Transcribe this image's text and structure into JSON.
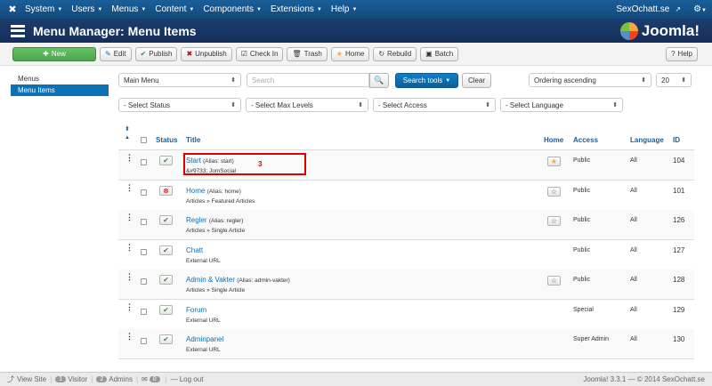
{
  "topbar": {
    "menus": [
      "System",
      "Users",
      "Menus",
      "Content",
      "Components",
      "Extensions",
      "Help"
    ],
    "site_name": "SexOchatt.se"
  },
  "header": {
    "title": "Menu Manager: Menu Items",
    "brand": "Joomla!"
  },
  "toolbar": {
    "new": "New",
    "edit": "Edit",
    "publish": "Publish",
    "unpublish": "Unpublish",
    "checkin": "Check In",
    "trash": "Trash",
    "home": "Home",
    "rebuild": "Rebuild",
    "batch": "Batch",
    "help": "Help"
  },
  "sidebar": {
    "items": [
      {
        "label": "Menus"
      },
      {
        "label": "Menu Items"
      }
    ]
  },
  "filters": {
    "menu_select": "Main Menu",
    "search_placeholder": "Search",
    "search_tools": "Search tools",
    "clear": "Clear",
    "ordering": "Ordering ascending",
    "limit": "20",
    "status": "- Select Status",
    "max_levels": "- Select Max Levels",
    "access": "- Select Access",
    "language": "- Select Language"
  },
  "table": {
    "headers": {
      "status": "Status",
      "title": "Title",
      "home": "Home",
      "access": "Access",
      "language": "Language",
      "id": "ID"
    },
    "rows": [
      {
        "title": "Start",
        "alias": "(Alias: start)",
        "sub": "&#9733; JomSocial",
        "published": true,
        "home": true,
        "access": "Public",
        "language": "All",
        "id": "104"
      },
      {
        "title": "Home",
        "alias": "(Alias: home)",
        "sub": "Articles » Featured Articles",
        "published": false,
        "home": false,
        "access": "Public",
        "language": "All",
        "id": "101"
      },
      {
        "title": "Regler",
        "alias": "(Alias: regler)",
        "sub": "Articles » Single Article",
        "published": true,
        "home": false,
        "access": "Public",
        "language": "All",
        "id": "126"
      },
      {
        "title": "Chatt",
        "alias": "",
        "sub": "External URL",
        "published": true,
        "home": null,
        "access": "Public",
        "language": "All",
        "id": "127"
      },
      {
        "title": "Admin & Vakter",
        "alias": "(Alias: admin-vakter)",
        "sub": "Articles » Single Article",
        "published": true,
        "home": false,
        "access": "Public",
        "language": "All",
        "id": "128"
      },
      {
        "title": "Forum",
        "alias": "",
        "sub": "External URL",
        "published": true,
        "home": null,
        "access": "Special",
        "language": "All",
        "id": "129"
      },
      {
        "title": "Adminpanel",
        "alias": "",
        "sub": "External URL",
        "published": true,
        "home": null,
        "access": "Super Admin",
        "language": "All",
        "id": "130"
      }
    ]
  },
  "annotation": "3",
  "statusbar": {
    "view_site": "View Site",
    "visitors_count": "1",
    "visitors_label": "Visitor",
    "admins_count": "2",
    "admins_label": "Admins",
    "messages_count": "0",
    "logout": "Log out",
    "version": "Joomla! 3.3.1",
    "copyright": "— © 2014 SexOchatt.se"
  }
}
